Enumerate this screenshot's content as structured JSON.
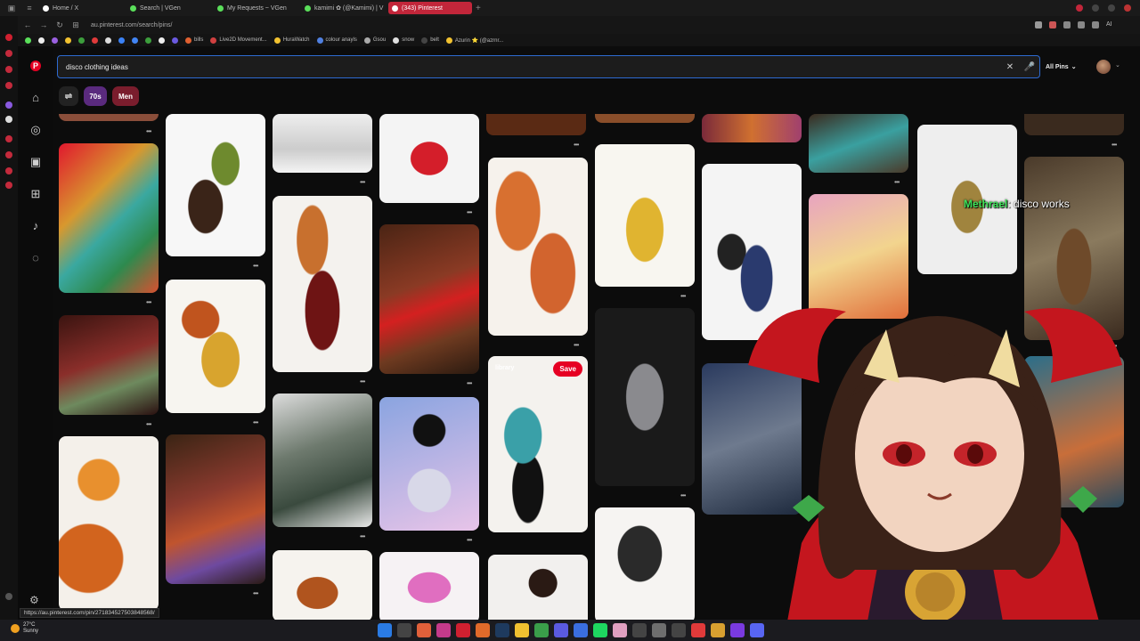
{
  "browser": {
    "tabs": [
      {
        "label": "Home / X",
        "color": "#ffffff",
        "active": false
      },
      {
        "label": "Search | VGen",
        "color": "#5adf5a",
        "active": false
      },
      {
        "label": "My Requests ~ VGen",
        "color": "#5adf5a",
        "active": false
      },
      {
        "label": "kamimi ✿ (@Kamimi) | V",
        "color": "#5adf5a",
        "active": false
      },
      {
        "label": "(343) Pinterest",
        "color": "#e60023",
        "active": true
      }
    ],
    "url": "au.pinterest.com/search/pins/",
    "ai_label": "AI",
    "bookmarks": [
      {
        "label": "bills",
        "color": "#e06030"
      },
      {
        "label": "Live2D Movement...",
        "color": "#d04040"
      },
      {
        "label": "HuraWatch",
        "color": "#f2c230"
      },
      {
        "label": "colour anayls",
        "color": "#5080e0"
      },
      {
        "label": "Gsou",
        "color": "#aaaaaa"
      },
      {
        "label": "snow",
        "color": "#e0e0e0"
      },
      {
        "label": "belt",
        "color": "#444444"
      },
      {
        "label": "Azurin ⭐ (@azrnr...",
        "color": "#f2c230"
      }
    ]
  },
  "search": {
    "query": "disco clothing ideas",
    "clear_icon": "✕",
    "mic_icon": "🎤",
    "filter_label": "All Pins"
  },
  "chips": [
    {
      "label": "70s",
      "color": "#5a2a7e"
    },
    {
      "label": "Men",
      "color": "#7a1d2d"
    }
  ],
  "pins": {
    "hover_save_label": "Save",
    "hover_board_label": "library"
  },
  "overlay": {
    "chat_user": "Methrael",
    "chat_message": ": disco works"
  },
  "status_url": "https://au.pinterest.com/pin/271834527503848568/",
  "taskbar": {
    "temp": "27°C",
    "weather": "Sunny"
  }
}
